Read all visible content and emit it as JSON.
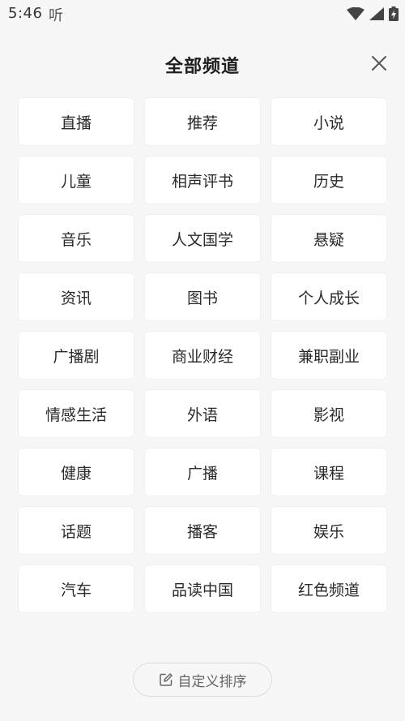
{
  "status_bar": {
    "time": "5:46",
    "app_icon_text": "听",
    "icons": [
      "wifi-icon",
      "cellular-signal-icon",
      "battery-charging-icon"
    ]
  },
  "header": {
    "title": "全部频道",
    "close_icon": "close-icon"
  },
  "channels": [
    "直播",
    "推荐",
    "小说",
    "儿童",
    "相声评书",
    "历史",
    "音乐",
    "人文国学",
    "悬疑",
    "资讯",
    "图书",
    "个人成长",
    "广播剧",
    "商业财经",
    "兼职副业",
    "情感生活",
    "外语",
    "影视",
    "健康",
    "广播",
    "课程",
    "话题",
    "播客",
    "娱乐",
    "汽车",
    "品读中国",
    "红色频道"
  ],
  "footer": {
    "sort_label": "自定义排序",
    "sort_icon": "edit-icon"
  }
}
